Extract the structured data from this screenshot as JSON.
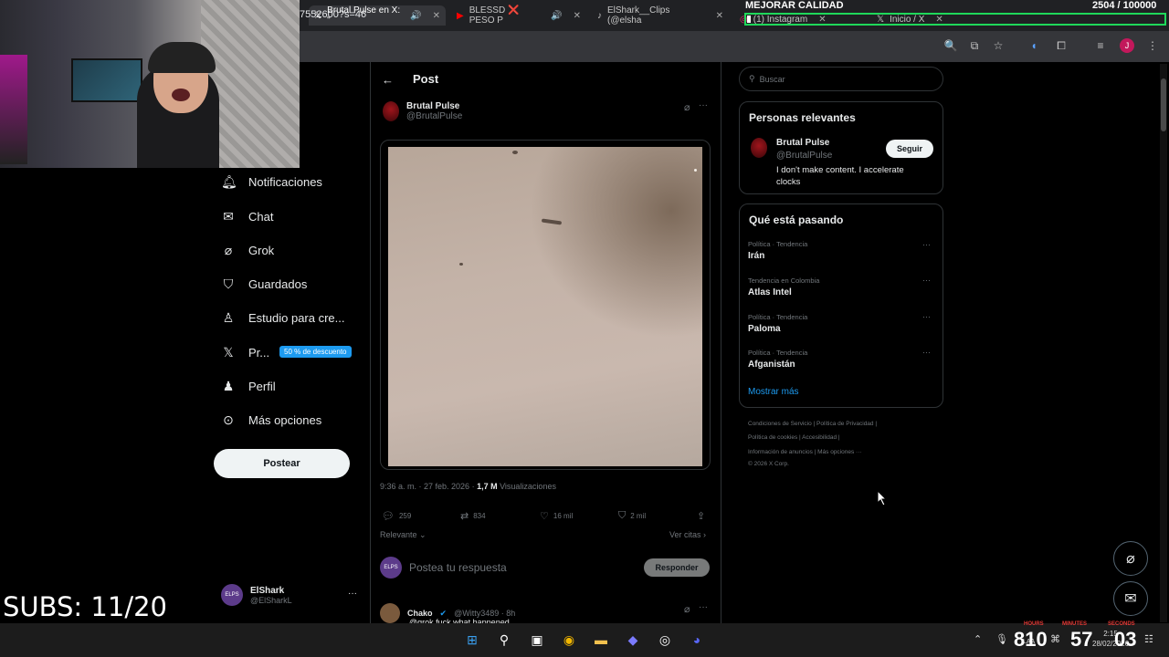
{
  "browser": {
    "tabs": [
      {
        "label": "Brutal Pulse en X: \"",
        "icon": "x-logo-icon"
      },
      {
        "label": "BLESSD ❌ PESO P",
        "icon": "youtube-icon"
      },
      {
        "label": "ElShark__Clips (@elsha",
        "icon": "tiktok-icon"
      },
      {
        "label": "(1) Instagram",
        "icon": "instagram-icon"
      },
      {
        "label": "Inicio / X",
        "icon": "x-logo-icon"
      }
    ],
    "url": "7552600?s=46",
    "profile_initial": "J"
  },
  "overlay": {
    "mejorar": "MEJORAR CALIDAD",
    "counter": "2504 / 100000",
    "subs": "SUBS: 11/20",
    "clock_hours": "810",
    "clock_minutes": "57",
    "clock_seconds": "03",
    "label_hours": "HOURS",
    "label_minutes": "MINUTES",
    "label_seconds": "SECONDS"
  },
  "nav": {
    "items": [
      {
        "label": "Notificaciones",
        "icon": "bell-icon"
      },
      {
        "label": "Chat",
        "icon": "mail-icon"
      },
      {
        "label": "Grok",
        "icon": "grok-icon"
      },
      {
        "label": "Guardados",
        "icon": "bookmark-icon"
      },
      {
        "label": "Estudio para cre...",
        "icon": "studio-icon"
      },
      {
        "label": "Pr...",
        "icon": "x-logo-icon"
      },
      {
        "label": "Perfil",
        "icon": "person-icon"
      },
      {
        "label": "Más opciones",
        "icon": "more-circle-icon"
      }
    ],
    "promo_badge": "50 % de descuento",
    "post_button": "Postear",
    "account_name": "ElShark",
    "account_handle": "@ElSharkL",
    "account_avatar": "ELPS"
  },
  "post": {
    "header_title": "Post",
    "author_name": "Brutal Pulse",
    "author_handle": "@BrutalPulse",
    "time": "9:36 a. m. · 27 feb. 2026 · ",
    "views": "1,7 M",
    "views_label": " Visualizaciones",
    "replies": "259",
    "reposts": "834",
    "likes": "16 mil",
    "bookmarks": "2 mil",
    "sort_label": "Relevante",
    "quotes_label": "Ver citas",
    "reply_placeholder": "Postea tu respuesta",
    "reply_button": "Responder",
    "reply_avatar": "ELPS"
  },
  "comment": {
    "name": "Chako",
    "handle": "@Witty3489 · 8h",
    "text_partial": "@grok fuck what happened"
  },
  "sidebar": {
    "search_placeholder": "Buscar",
    "relevant_title": "Personas relevantes",
    "relevant_name": "Brutal Pulse",
    "relevant_handle": "@BrutalPulse",
    "relevant_bio": "I don't make content. I accelerate clocks",
    "follow_button": "Seguir",
    "trends_title": "Qué está pasando",
    "trends": [
      {
        "category": "Política · Tendencia",
        "name": "Irán"
      },
      {
        "category": "Tendencia en Colombia",
        "name": "Atlas Intel"
      },
      {
        "category": "Política · Tendencia",
        "name": "Paloma"
      },
      {
        "category": "Política · Tendencia",
        "name": "Afganistán"
      }
    ],
    "show_more": "Mostrar más",
    "footer_line1": "Condiciones de Servicio  |  Política de Privacidad  |",
    "footer_line2": "Política de cookies  |  Accesibilidad  |",
    "footer_line3": "Información de anuncios  |  Más opciones ···",
    "footer_line4": "© 2026 X Corp."
  },
  "taskbar": {
    "time": "2:15",
    "date": "28/02/2026",
    "lang": "LAA"
  },
  "colors": {
    "accent": "#1d9bf0",
    "background": "#000000",
    "border": "#2f3336",
    "overlay_green": "#1fd85a"
  }
}
